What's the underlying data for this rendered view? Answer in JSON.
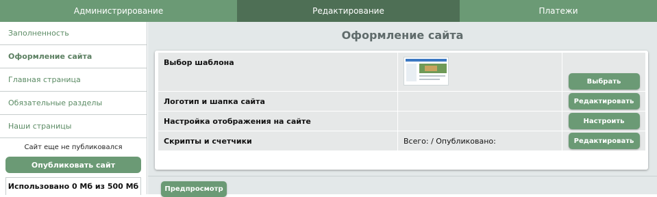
{
  "topnav": {
    "tabs": [
      {
        "label": "Администрирование"
      },
      {
        "label": "Редактирование"
      },
      {
        "label": "Платежи"
      }
    ]
  },
  "sidebar": {
    "items": [
      {
        "label": "Заполненность"
      },
      {
        "label": "Оформление сайта"
      },
      {
        "label": "Главная страница"
      },
      {
        "label": "Обязательные разделы"
      },
      {
        "label": "Наши страницы"
      }
    ],
    "status": "Сайт еще не публиковался",
    "publish_label": "Опубликовать сайт",
    "usage": "Использовано 0 Мб из 500 Мб"
  },
  "main": {
    "title": "Оформление сайта",
    "rows": [
      {
        "label": "Выбор шаблона",
        "info": "",
        "action": "Выбрать"
      },
      {
        "label": "Логотип и шапка сайта",
        "info": "",
        "action": "Редактировать"
      },
      {
        "label": "Настройка отображения на сайте",
        "info": "",
        "action": "Настроить"
      },
      {
        "label": "Скрипты и счетчики",
        "info": "Всего: / Опубликовано:",
        "action": "Редактировать"
      }
    ],
    "preview_label": "Предпросмотр"
  },
  "colors": {
    "nav": "#6b9a75",
    "nav_active": "#4e6f55",
    "button": "#6b9a75",
    "main_bg": "#e3e8e9"
  }
}
